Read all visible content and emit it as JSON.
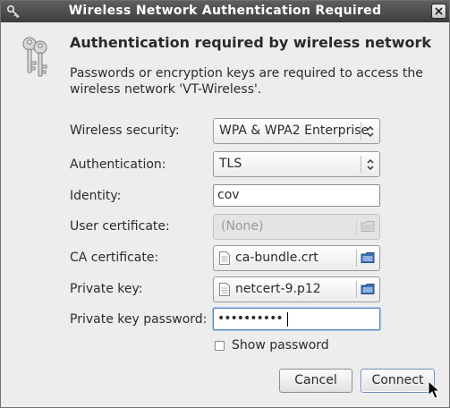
{
  "window": {
    "title": "Wireless Network Authentication Required"
  },
  "header": {
    "heading": "Authentication required by wireless network",
    "description": "Passwords or encryption keys are required to access the wireless network 'VT-Wireless'."
  },
  "form": {
    "wireless_security": {
      "label": "Wireless security:",
      "value": "WPA & WPA2 Enterprise"
    },
    "authentication": {
      "label": "Authentication:",
      "value": "TLS"
    },
    "identity": {
      "label": "Identity:",
      "value": "cov"
    },
    "user_certificate": {
      "label": "User certificate:",
      "value": "(None)"
    },
    "ca_certificate": {
      "label": "CA certificate:",
      "value": "ca-bundle.crt"
    },
    "private_key": {
      "label": "Private key:",
      "value": "netcert-9.p12"
    },
    "private_key_password": {
      "label": "Private key password:",
      "value": "••••••••••"
    },
    "show_password": {
      "label": "Show password",
      "checked": false
    }
  },
  "buttons": {
    "cancel": "Cancel",
    "connect": "Connect"
  },
  "icons": {
    "window": "keys-icon",
    "dialog": "keys-icon",
    "close": "close-icon",
    "combo_arrow": "up-down-arrows-icon",
    "file": "document-icon",
    "folder": "folder-icon"
  },
  "colors": {
    "titlebar": "#4a4a4a",
    "dialog_bg": "#ededed",
    "focus_border": "#5a87c4"
  }
}
